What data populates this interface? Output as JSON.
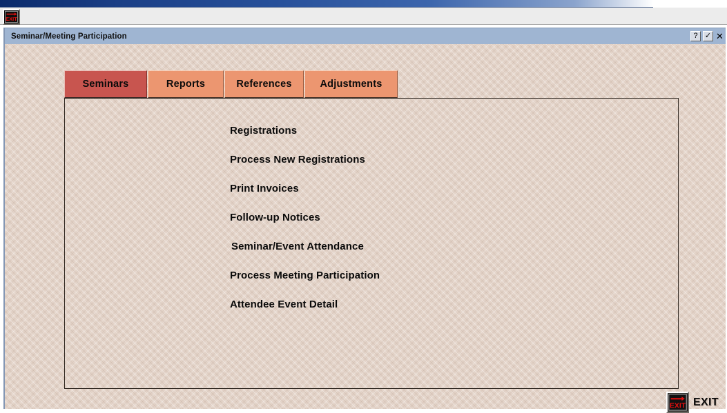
{
  "parent_window": {
    "toolbar": {
      "exit_button": {
        "icon": "exit-sign-icon",
        "tooltip": "Exit"
      }
    }
  },
  "child_window": {
    "title": "Seminar/Meeting Participation",
    "controls": [
      {
        "name": "help-button",
        "label": "?",
        "icon": "question-mark-icon"
      },
      {
        "name": "accept-button",
        "label": "✓",
        "icon": "checkmark-icon"
      },
      {
        "name": "close-button",
        "label": "✕",
        "icon": "close-x-icon"
      }
    ]
  },
  "tabs": [
    {
      "label": "Seminars",
      "active": true
    },
    {
      "label": "Reports",
      "active": false
    },
    {
      "label": "References",
      "active": false
    },
    {
      "label": "Adjustments",
      "active": false
    }
  ],
  "menu": {
    "items": [
      {
        "label": "Registrations"
      },
      {
        "label": "Process New Registrations"
      },
      {
        "label": "Print Invoices"
      },
      {
        "label": "Follow-up Notices"
      },
      {
        "label": "Seminar/Event Attendance"
      },
      {
        "label": "Process Meeting Participation"
      },
      {
        "label": "Attendee Event Detail"
      }
    ]
  },
  "footer": {
    "exit_label": "EXIT",
    "exit_icon": "exit-sign-icon"
  },
  "colors": {
    "active_tab": "#c8554f",
    "inactive_tab": "#ec9670",
    "titlebar": "#9fb5d2",
    "client_background": "#e3d3c8",
    "os_caption": "#1b3f86",
    "exit_red": "#e01010"
  }
}
